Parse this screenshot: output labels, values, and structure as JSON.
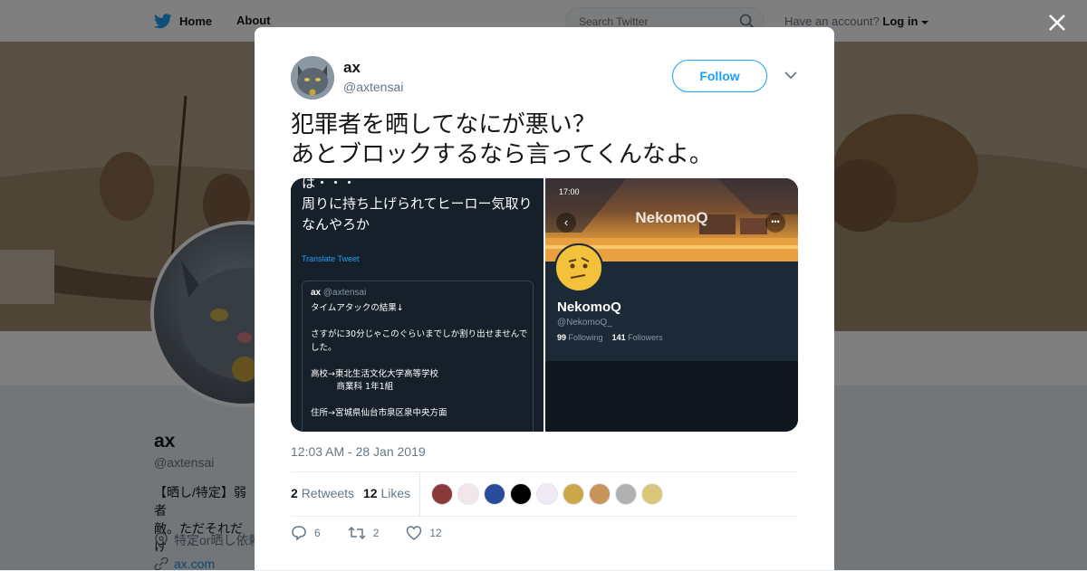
{
  "topbar": {
    "home_label": "Home",
    "about_label": "About",
    "search_placeholder": "Search Twitter",
    "have_account": "Have an account?",
    "login_label": "Log in"
  },
  "profile_background": {
    "name": "ax",
    "handle": "@axtensai",
    "bio": "【晒し/特定】弱者\n敵。ただそれだけ",
    "location": "特定or晒し依頼",
    "url": "ax.com"
  },
  "tweet": {
    "author_name": "ax",
    "author_handle": "@axtensai",
    "follow_label": "Follow",
    "text": "犯罪者を晒してなにが悪い？\nあとブロックするなら言ってくんなよ。",
    "timestamp": "12:03 AM - 28 Jan 2019",
    "retweets_count": "2",
    "retweets_label": "Retweets",
    "likes_count": "12",
    "likes_label": "Likes",
    "reply_count": "6",
    "retweet_count": "2",
    "like_count": "12",
    "liker_colors": [
      "#8a3a3a",
      "#f2e6ea",
      "#2a4a9a",
      "#000000",
      "#efe8f5",
      "#caa84a",
      "#c9945a",
      "#b0b0b0",
      "#d9c77a"
    ]
  },
  "media_left": {
    "text": "は・・・\n周りに持ち上げられてヒーロー気取りなんやろか",
    "translate_label": "Translate Tweet",
    "quote_name": "ax",
    "quote_handle": "@axtensai",
    "quote_body": "タイムアタックの結果↓\n\nさすがに30分じゃこのぐらいまでしか割り出せませんでした。\n\n高校→東北生活文化大学高等学校\n　　　商業科 1年1組\n\n住所→宮城県仙台市泉区泉中央方面"
  },
  "media_right": {
    "status_time": "17:00",
    "header_title": "NekomoQ",
    "profile_name": "NekomoQ",
    "profile_handle": "@NekomoQ_",
    "following_count": "99",
    "following_label": "Following",
    "followers_count": "141",
    "followers_label": "Followers"
  },
  "colors": {
    "brand": "#1da1f2",
    "link": "#1b95e0",
    "dark_bg": "#15202b"
  }
}
